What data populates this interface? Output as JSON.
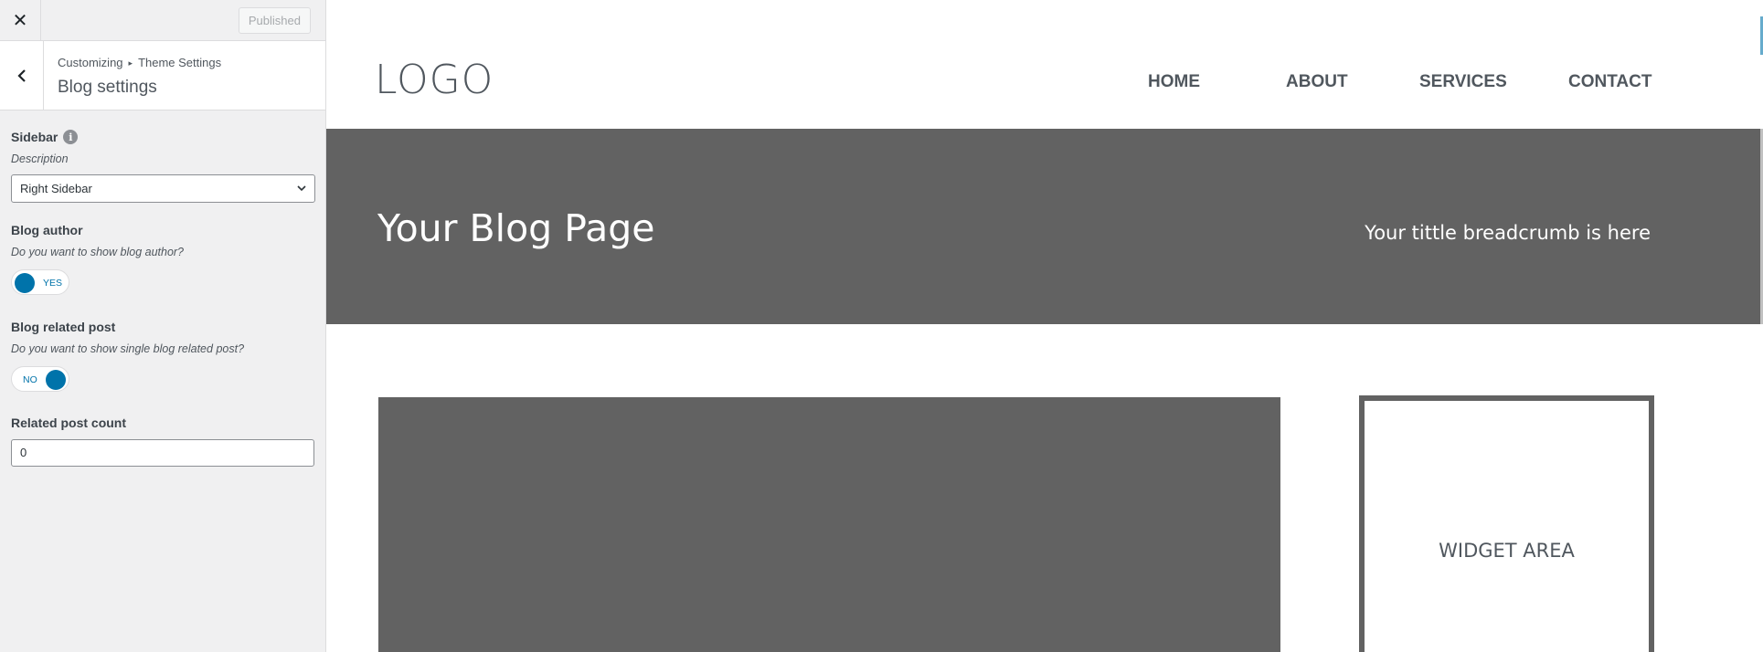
{
  "customizer": {
    "publish_label": "Published",
    "breadcrumb": {
      "root": "Customizing",
      "separator": "▸",
      "parent": "Theme Settings"
    },
    "section_title": "Blog settings",
    "controls": {
      "sidebar": {
        "label": "Sidebar",
        "description": "Description",
        "selected": "Right Sidebar"
      },
      "blog_author": {
        "label": "Blog author",
        "description": "Do you want to show blog author?",
        "toggle_text": "YES",
        "value": true
      },
      "related_post": {
        "label": "Blog related post",
        "description": "Do you want to show single blog related post?",
        "toggle_text": "NO",
        "value": false
      },
      "related_count": {
        "label": "Related post count",
        "value": "0"
      }
    }
  },
  "preview": {
    "logo": "LOGO",
    "nav": [
      "HOME",
      "ABOUT",
      "SERVICES",
      "CONTACT"
    ],
    "hero_title": "Your Blog Page",
    "hero_breadcrumb": "Your tittle breadcrumb is here",
    "widget_label": "WIDGET AREA"
  },
  "colors": {
    "accent": "#0073aa",
    "placeholder_gray": "#626262",
    "sidebar_bg": "#f0f0f1"
  }
}
